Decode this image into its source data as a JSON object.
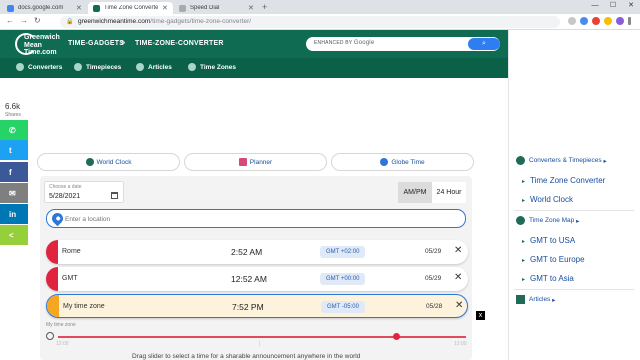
{
  "browser": {
    "tabs": [
      {
        "title": "docs.google.com",
        "favicon_color": "#4285f4"
      },
      {
        "title": "Time Zone Converter | GMT",
        "favicon_color": "#0f6b52"
      },
      {
        "title": "Speed Dial",
        "favicon_color": "#aaaaaa"
      }
    ],
    "url_host": "greenwichmeantime.com",
    "url_path": "/time-gadgets/time-zone-converter/",
    "new_tab_glyph": "+",
    "window_controls": [
      "—",
      "☐",
      "✕"
    ]
  },
  "header": {
    "logo_lines": [
      "Greenwich",
      "Mean",
      "Time.com"
    ],
    "breadcrumb": [
      "TIME-GADGETS",
      "TIME-ZONE-CONVERTER"
    ],
    "breadcrumb_sep": ">",
    "search_label_small": "ENHANCED BY",
    "search_label_brand": "Google",
    "search_button_icon": "search-icon"
  },
  "nav": [
    {
      "label": "Converters",
      "icon": "converters-icon"
    },
    {
      "label": "Timepieces",
      "icon": "clock-icon"
    },
    {
      "label": "Articles",
      "icon": "articles-icon"
    },
    {
      "label": "Time Zones",
      "icon": "globe-icon"
    }
  ],
  "share": {
    "count": "6.6k",
    "label": "Shares",
    "buttons": [
      {
        "name": "whatsapp",
        "color": "#25d366",
        "glyph": "✆"
      },
      {
        "name": "twitter",
        "color": "#1da1f2",
        "glyph": "t"
      },
      {
        "name": "facebook",
        "color": "#3b5998",
        "glyph": "f"
      },
      {
        "name": "email",
        "color": "#7f7f7f",
        "glyph": "✉"
      },
      {
        "name": "linkedin",
        "color": "#0077b5",
        "glyph": "in"
      },
      {
        "name": "sharethis",
        "color": "#95d03a",
        "glyph": "<"
      }
    ]
  },
  "gadgets": [
    {
      "label": "World Clock",
      "icon_color": "#1f6b58"
    },
    {
      "label": "Planner",
      "icon_color": "#d64a7a"
    },
    {
      "label": "Globe Time",
      "icon_color": "#2c77d8"
    }
  ],
  "converter": {
    "date_label": "Choose a date",
    "date_value": "5/28/2021",
    "format_ampm": "AM/PM",
    "format_24": "24 Hour",
    "location_placeholder": "Enter a location",
    "rows": [
      {
        "city": "Rome",
        "time": "2:52 AM",
        "offset": "GMT +02:00",
        "date": "05/29",
        "color": "#e0243f"
      },
      {
        "city": "GMT",
        "time": "12:52 AM",
        "offset": "GMT +00:00",
        "date": "05/29",
        "color": "#e0243f"
      },
      {
        "city": "My time zone",
        "time": "7:52 PM",
        "offset": "GMT -05:00",
        "date": "05/28",
        "color": "#f5a623"
      }
    ],
    "remove_glyph": "✕",
    "slider_label": "My time zone",
    "slider_ticks": [
      "12:00",
      "|",
      "12:00"
    ],
    "slider_value_fraction": 0.83,
    "help_text": "Drag slider to select a time for a sharable announcement anywhere in the world"
  },
  "sidebar": {
    "section1": "Converters & Timepieces",
    "section1_items": [
      "Time Zone Converter",
      "World Clock"
    ],
    "section2": "Time Zone Map",
    "section2_items": [
      "GMT to USA",
      "GMT to Europe",
      "GMT to Asia"
    ],
    "section3": "Articles",
    "chevron": "▸",
    "item_arrow": "▸"
  },
  "ad_close_glyph": "x"
}
